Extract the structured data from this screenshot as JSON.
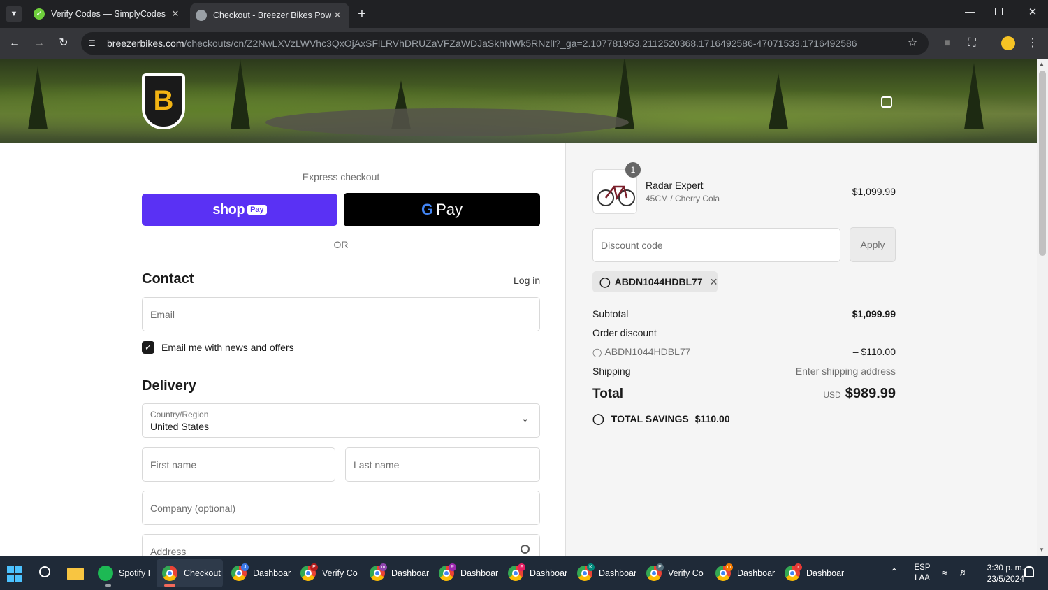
{
  "browser": {
    "tabs": [
      {
        "title": "Verify Codes — SimplyCodes",
        "favicon": "check-circle-icon"
      },
      {
        "title": "Checkout - Breezer Bikes Powered",
        "favicon": "globe-icon"
      }
    ],
    "url_host": "breezerbikes.com",
    "url_path": "/checkouts/cn/Z2NwLXVzLWVhc3QxOjAxSFlLRVhDRUZaVFZaWDJaSkhNWk5RNzlI?_ga=2.107781953.2112520368.1716492586-47071533.1716492586"
  },
  "store": {
    "logo_letter": "B",
    "cart_icon": "bag-icon"
  },
  "checkout": {
    "express_label": "Express checkout",
    "shop_pay_label": "shop",
    "shop_pay_badge": "Pay",
    "gpay_g": "G",
    "gpay_label": "Pay",
    "or_label": "OR",
    "contact_heading": "Contact",
    "login_link": "Log in",
    "email_placeholder": "Email",
    "newsletter_label": "Email me with news and offers",
    "newsletter_checked": true,
    "delivery_heading": "Delivery",
    "country_label": "Country/Region",
    "country_value": "United States",
    "first_name_placeholder": "First name",
    "last_name_placeholder": "Last name",
    "company_placeholder": "Company (optional)",
    "address_placeholder": "Address"
  },
  "summary": {
    "product_qty": "1",
    "product_name": "Radar Expert",
    "product_variant": "45CM / Cherry Cola",
    "product_price": "$1,099.99",
    "discount_placeholder": "Discount code",
    "apply_label": "Apply",
    "applied_code": "ABDN1044HDBL77",
    "subtotal_label": "Subtotal",
    "subtotal_value": "$1,099.99",
    "order_discount_label": "Order discount",
    "discount_code_line": "ABDN1044HDBL77",
    "discount_amount": "– $110.00",
    "shipping_label": "Shipping",
    "shipping_value": "Enter shipping address",
    "total_label": "Total",
    "currency": "USD",
    "total_value": "$989.99",
    "savings_label": "TOTAL SAVINGS",
    "savings_value": "$110.00"
  },
  "taskbar": {
    "apps": [
      {
        "label": "Spotify I",
        "icon": "spotify-icon"
      },
      {
        "label": "Checkout",
        "icon": "chrome-icon"
      },
      {
        "label": "Dashboar",
        "icon": "chrome-icon",
        "badge": "J"
      },
      {
        "label": "Verify Co",
        "icon": "chrome-icon",
        "badge": "E"
      },
      {
        "label": "Dashboar",
        "icon": "chrome-icon",
        "badge": "m"
      },
      {
        "label": "Dashboar",
        "icon": "chrome-icon",
        "badge": "R"
      },
      {
        "label": "Dashboar",
        "icon": "chrome-icon",
        "badge": "F"
      },
      {
        "label": "Dashboar",
        "icon": "chrome-icon",
        "badge": "K"
      },
      {
        "label": "Verify Co",
        "icon": "chrome-icon",
        "badge": "E"
      },
      {
        "label": "Dashboar",
        "icon": "chrome-icon",
        "badge": "m"
      },
      {
        "label": "Dashboar",
        "icon": "chrome-icon",
        "badge": "r"
      }
    ],
    "lang_top": "ESP",
    "lang_bottom": "LAA",
    "time": "3:30 p. m.",
    "date": "23/5/2024"
  },
  "colors": {
    "shop_pay": "#5a31f4",
    "gpay": "#000000",
    "taskbar": "#1f2a38",
    "chrome_dark": "#202124"
  }
}
